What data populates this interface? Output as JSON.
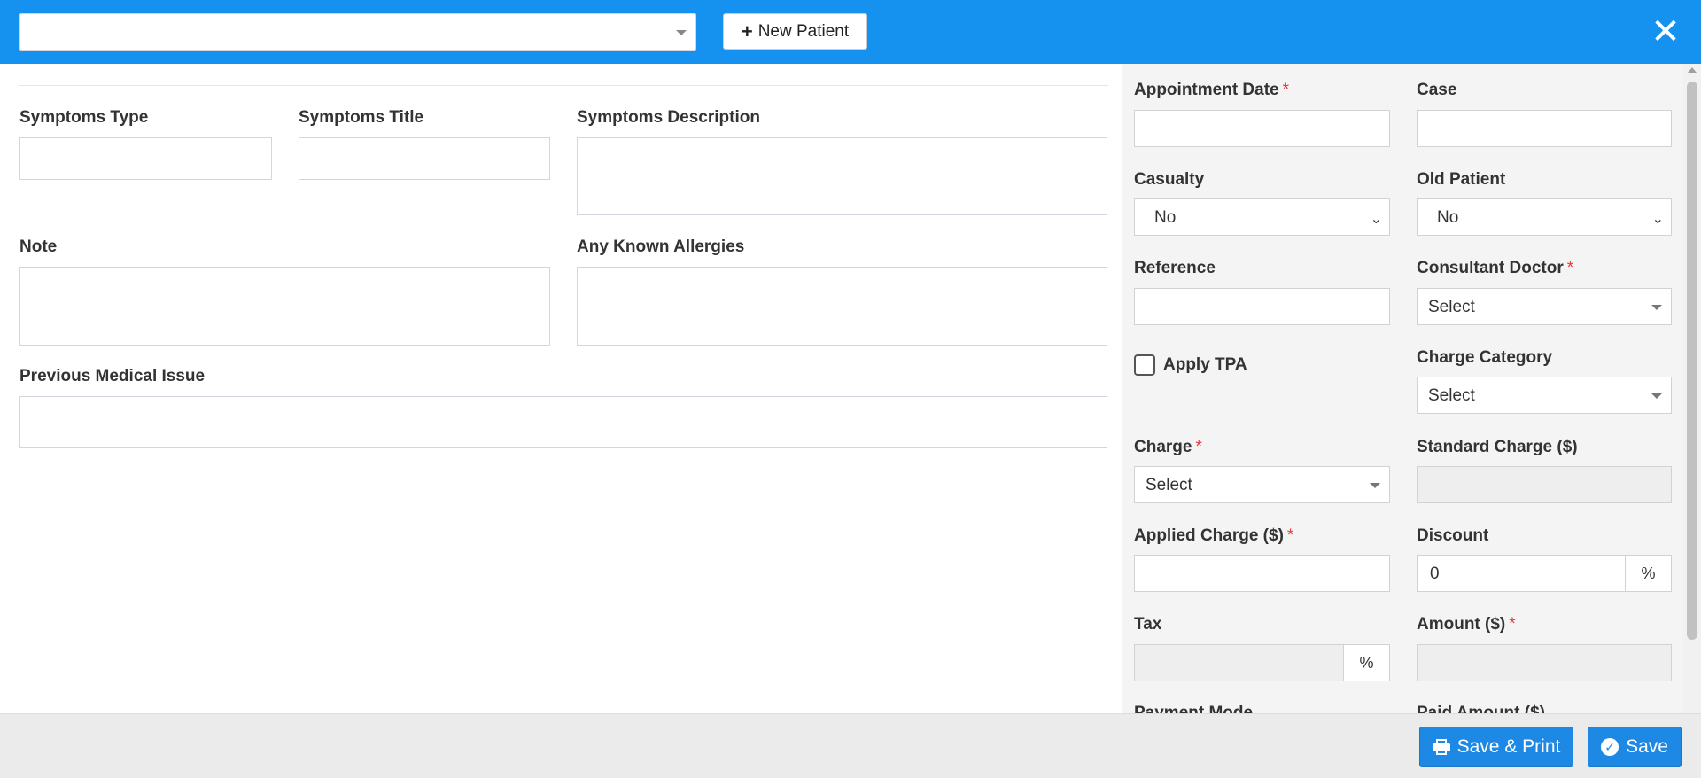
{
  "header": {
    "patient_select_value": "",
    "new_patient_label": "New Patient",
    "close_glyph": "✕"
  },
  "form": {
    "symptoms_type_label": "Symptoms Type",
    "symptoms_title_label": "Symptoms Title",
    "symptoms_description_label": "Symptoms Description",
    "note_label": "Note",
    "allergies_label": "Any Known Allergies",
    "previous_issue_label": "Previous Medical Issue"
  },
  "panel": {
    "appointment_date_label": "Appointment Date",
    "case_label": "Case",
    "casualty_label": "Casualty",
    "casualty_value": "No",
    "old_patient_label": "Old Patient",
    "old_patient_value": "No",
    "reference_label": "Reference",
    "consultant_doctor_label": "Consultant Doctor",
    "consultant_doctor_value": "Select",
    "apply_tpa_label": "Apply TPA",
    "charge_category_label": "Charge Category",
    "charge_category_value": "Select",
    "charge_label": "Charge",
    "charge_value": "Select",
    "standard_charge_label": "Standard Charge ($)",
    "applied_charge_label": "Applied Charge ($)",
    "discount_label": "Discount",
    "discount_value": "0",
    "percent_symbol": "%",
    "tax_label": "Tax",
    "amount_label": "Amount ($)",
    "payment_mode_label": "Payment Mode",
    "paid_amount_label": "Paid Amount ($)",
    "required_mark": "*"
  },
  "footer": {
    "save_print_label": "Save & Print",
    "save_label": "Save"
  },
  "colors": {
    "header_bg": "#1592ef",
    "button_bg": "#1e88e5",
    "required": "#e53935"
  }
}
